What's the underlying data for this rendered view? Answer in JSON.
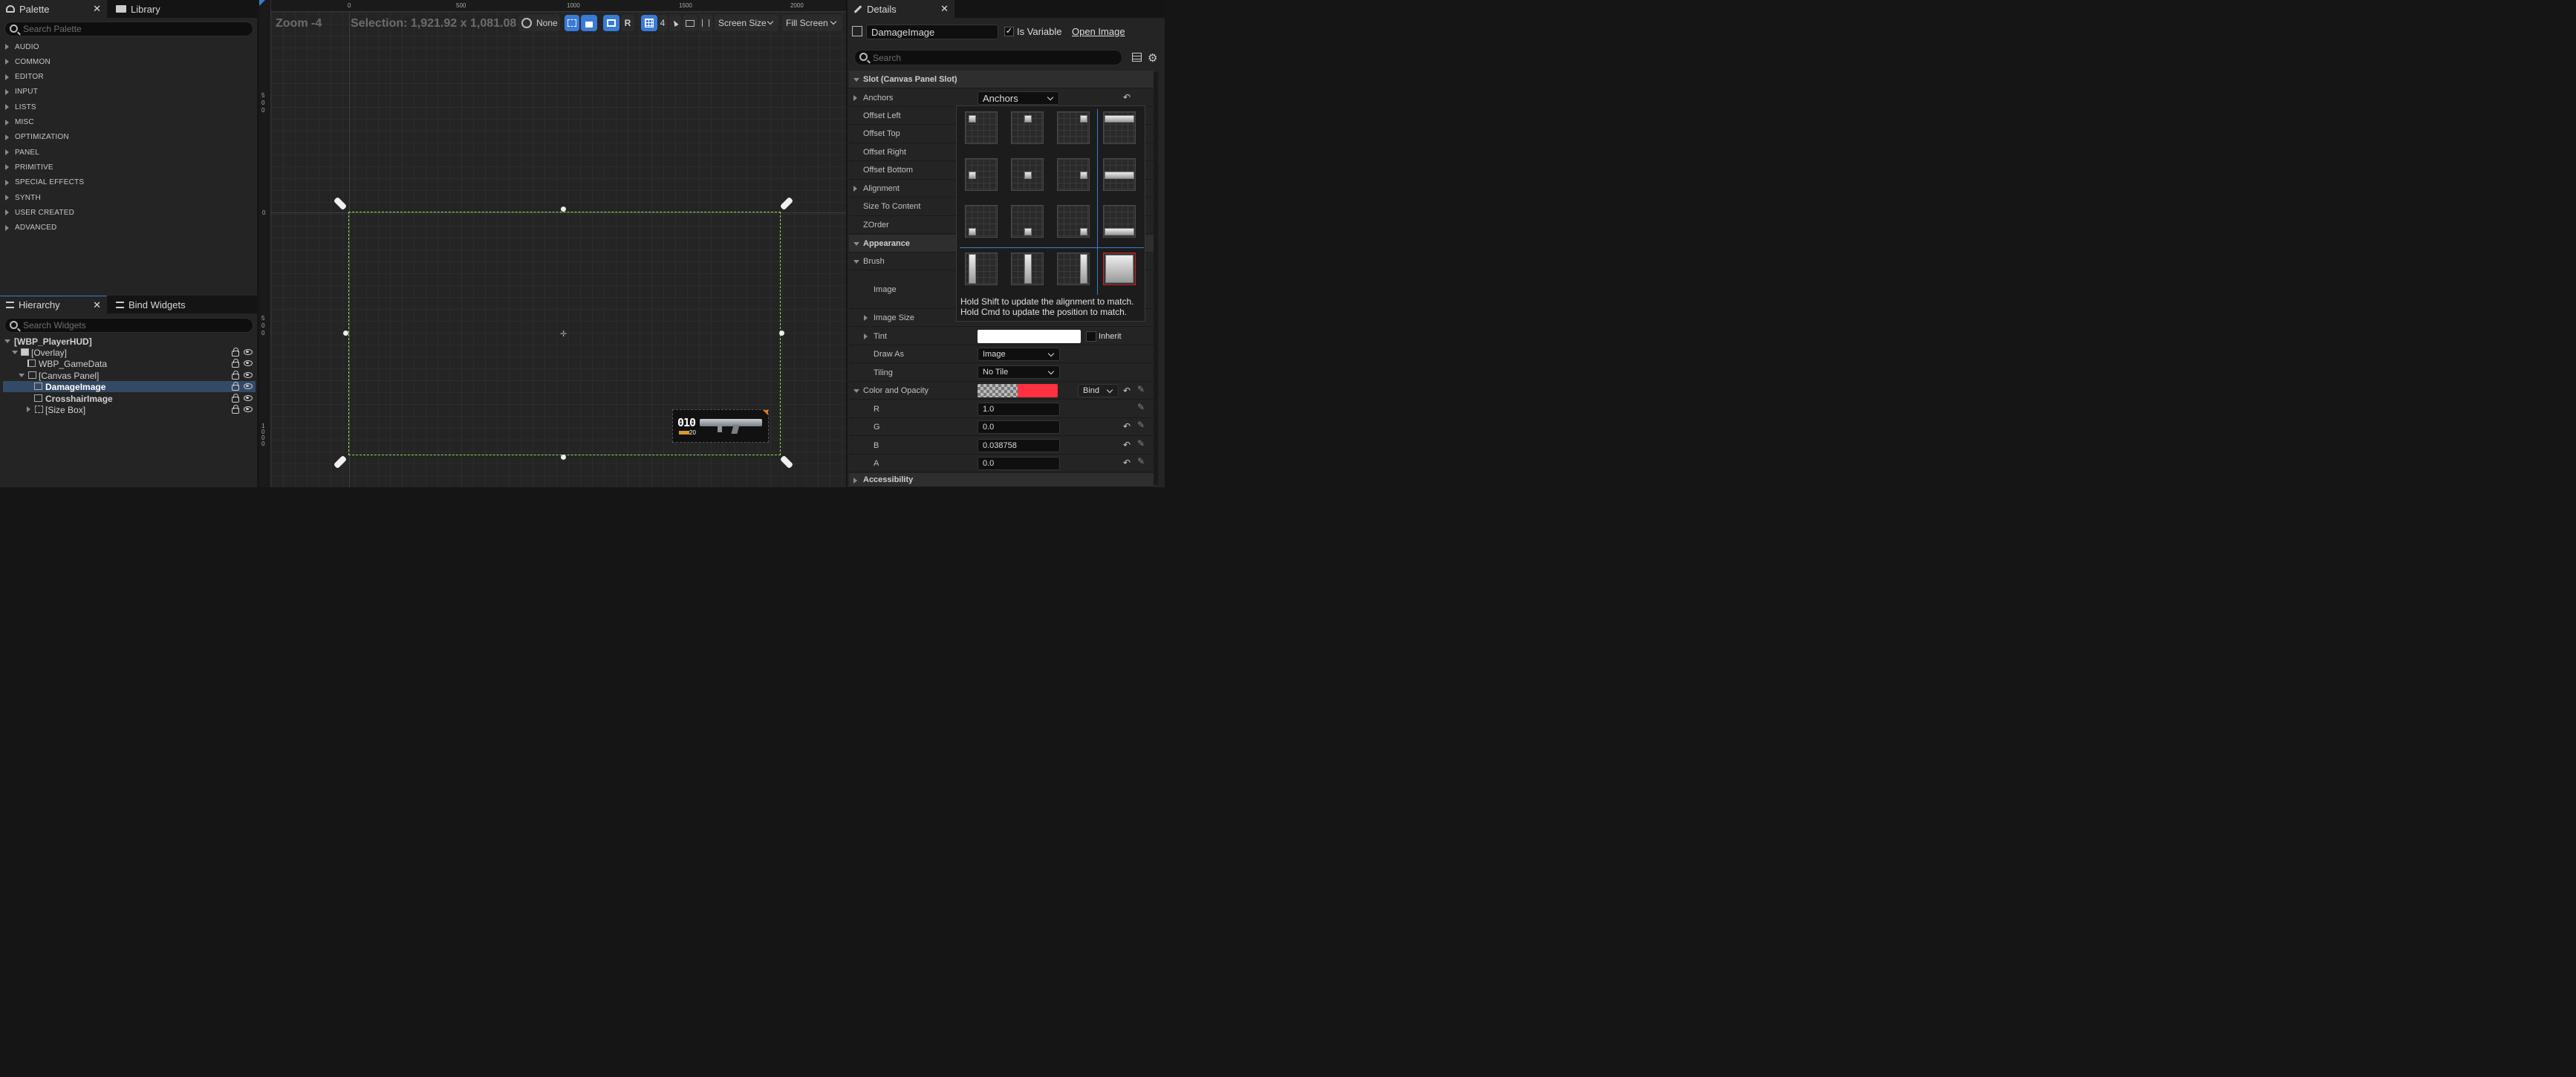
{
  "palette": {
    "tab_label": "Palette",
    "tab2_label": "Library",
    "search_placeholder": "Search Palette",
    "categories": [
      "AUDIO",
      "COMMON",
      "EDITOR",
      "INPUT",
      "LISTS",
      "MISC",
      "OPTIMIZATION",
      "PANEL",
      "PRIMITIVE",
      "SPECIAL EFFECTS",
      "SYNTH",
      "USER CREATED",
      "ADVANCED"
    ]
  },
  "hierarchy": {
    "tab_label": "Hierarchy",
    "tab2_label": "Bind Widgets",
    "search_placeholder": "Search Widgets",
    "items": [
      {
        "label": "[WBP_PlayerHUD]",
        "bold": true
      },
      {
        "label": "[Overlay]"
      },
      {
        "label": "WBP_GameData"
      },
      {
        "label": "[Canvas Panel]"
      },
      {
        "label": "DamageImage",
        "bold": true,
        "selected": true
      },
      {
        "label": "CrosshairImage",
        "bold": true
      },
      {
        "label": "[Size Box]"
      }
    ]
  },
  "viewport": {
    "zoom": "Zoom -4",
    "selection": "Selection: 1,921.92 x 1,081.08",
    "ruler_top": [
      "0",
      "500",
      "1000",
      "1500",
      "2000"
    ],
    "ruler_left": [
      "500",
      "0",
      "500",
      "1000"
    ],
    "toolbar": {
      "none_label": "None",
      "r_label": "R",
      "grid_value": "4",
      "screen_size": "Screen Size",
      "fill_screen": "Fill Screen"
    },
    "thumbnail": {
      "ammo": "010",
      "reserve": "20"
    }
  },
  "details": {
    "tab_label": "Details",
    "widget_name": "DamageImage",
    "is_variable_label": "Is Variable",
    "is_variable": true,
    "open_image": "Open Image",
    "search_placeholder": "Search",
    "slot_section": "Slot (Canvas Panel Slot)",
    "anchors_label": "Anchors",
    "anchors_value": "Anchors",
    "rows": [
      "Offset Left",
      "Offset Top",
      "Offset Right",
      "Offset Bottom",
      "Alignment",
      "Size To Content",
      "ZOrder"
    ],
    "appearance_section": "Appearance",
    "brush_label": "Brush",
    "image_label": "Image",
    "image_size_label": "Image Size",
    "tint_label": "Tint",
    "inherit_label": "Inherit",
    "draw_as_label": "Draw As",
    "draw_as_value": "Image",
    "tiling_label": "Tiling",
    "tiling_value": "No Tile",
    "color_opacity_label": "Color and Opacity",
    "bind_label": "Bind",
    "r_label": "R",
    "r_value": "1.0",
    "g_label": "G",
    "g_value": "0.0",
    "b_label": "B",
    "b_value": "0.038758",
    "a_label": "A",
    "a_value": "0.0",
    "accessibility_section": "Accessibility",
    "anchor_hint_1": "Hold Shift to update the alignment to match.",
    "anchor_hint_2": "Hold Cmd to update the position to match.",
    "color_swatch": "#ff3040"
  }
}
